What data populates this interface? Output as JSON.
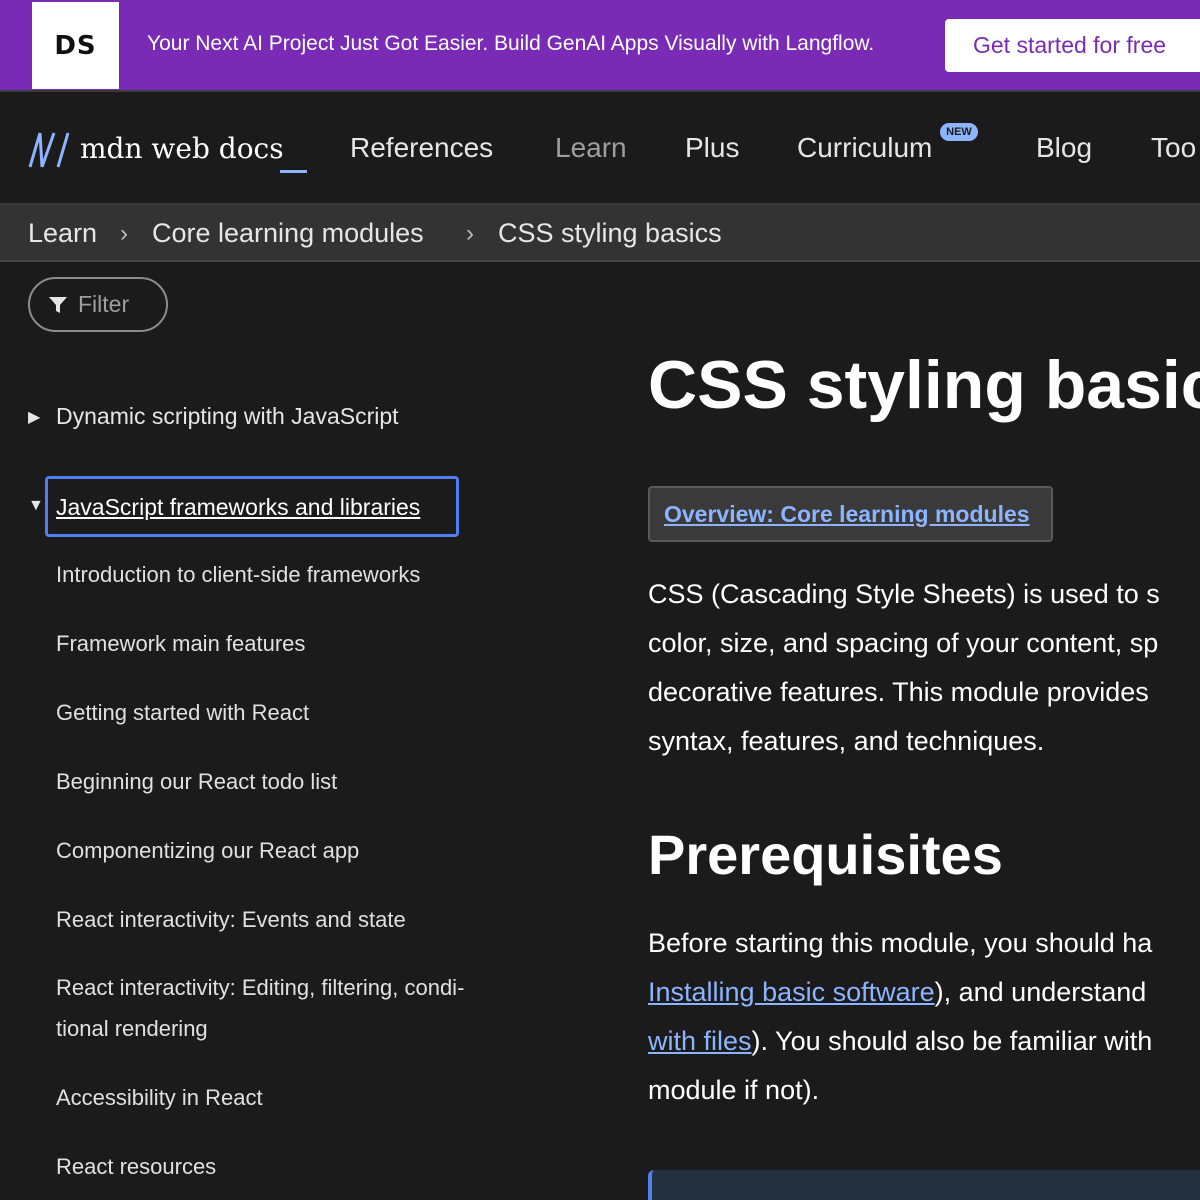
{
  "banner": {
    "logo": "DS",
    "text": "Your Next AI Project Just Got Easier. Build GenAI Apps Visually with Langflow.",
    "cta": "Get started for free"
  },
  "nav": {
    "logo_text": "mdn web docs",
    "items": [
      "References",
      "Learn",
      "Plus",
      "Curriculum",
      "Blog",
      "Too"
    ],
    "new_badge": "NEW"
  },
  "breadcrumb": [
    "Learn",
    "Core learning modules",
    "CSS styling basics"
  ],
  "sidebar": {
    "filter_placeholder": "Filter",
    "collapsed_section": "Dynamic scripting with JavaScript",
    "expanded_section": "JavaScript frameworks and libraries",
    "items": [
      "Introduction to client-side frameworks",
      "Framework main features",
      "Getting started with React",
      "Beginning our React todo list",
      "Componentizing our React app",
      "React interactivity: Events and state",
      "React interactivity: Editing, filtering, condi-",
      "tional rendering",
      "Accessibility in React",
      "React resources"
    ]
  },
  "main": {
    "title": "CSS styling basic",
    "overview_link": "Overview: Core learning modules",
    "intro_lines": [
      "CSS (Cascading Style Sheets) is used to s",
      "color, size, and spacing of your content, sp",
      "decorative features. This module provides",
      "syntax, features, and techniques."
    ],
    "prereq_heading": "Prerequisites",
    "prereq": {
      "line1": "Before starting this module, you should ha",
      "link1": "Installing basic software",
      "line2_rest": "), and understand",
      "link2": "with files",
      "line3_rest": "). You should also be familiar with",
      "line4": "module if not)."
    }
  },
  "colors": {
    "banner_bg": "#7a2bb5",
    "page_bg": "#1b1b1b",
    "link": "#8cb4ff",
    "focus": "#4f7ff2"
  }
}
